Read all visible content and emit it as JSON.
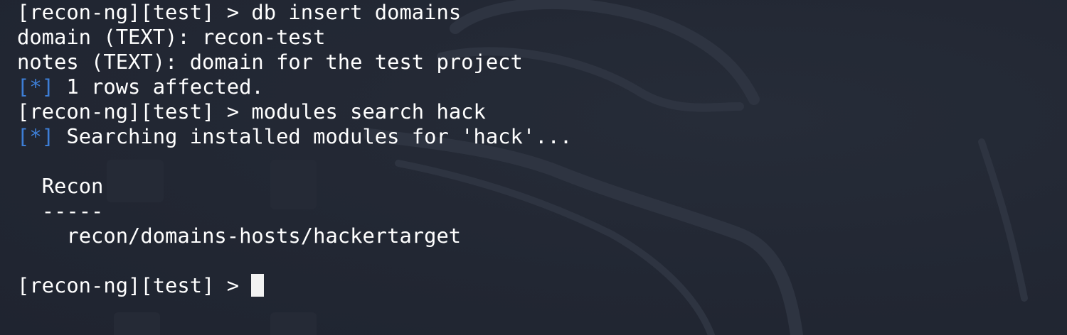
{
  "terminal": {
    "prompt": "[recon-ng][test] >",
    "status_marker": "[*]",
    "lines": {
      "cmd_insert": "db insert domains",
      "domain_input": "domain (TEXT): recon-test",
      "notes_input": "notes (TEXT): domain for the test project",
      "rows_affected": "1 rows affected.",
      "cmd_search": "modules search hack",
      "searching": "Searching installed modules for 'hack'...",
      "section_title": "Recon",
      "section_underline": "-----",
      "module_result": "recon/domains-hosts/hackertarget"
    },
    "colors": {
      "background": "#232834",
      "text": "#ffffff",
      "status_marker": "#3d7ed6",
      "cursor": "#f2f2f2"
    },
    "icons": {
      "background": "kali-dragon-icon"
    }
  }
}
